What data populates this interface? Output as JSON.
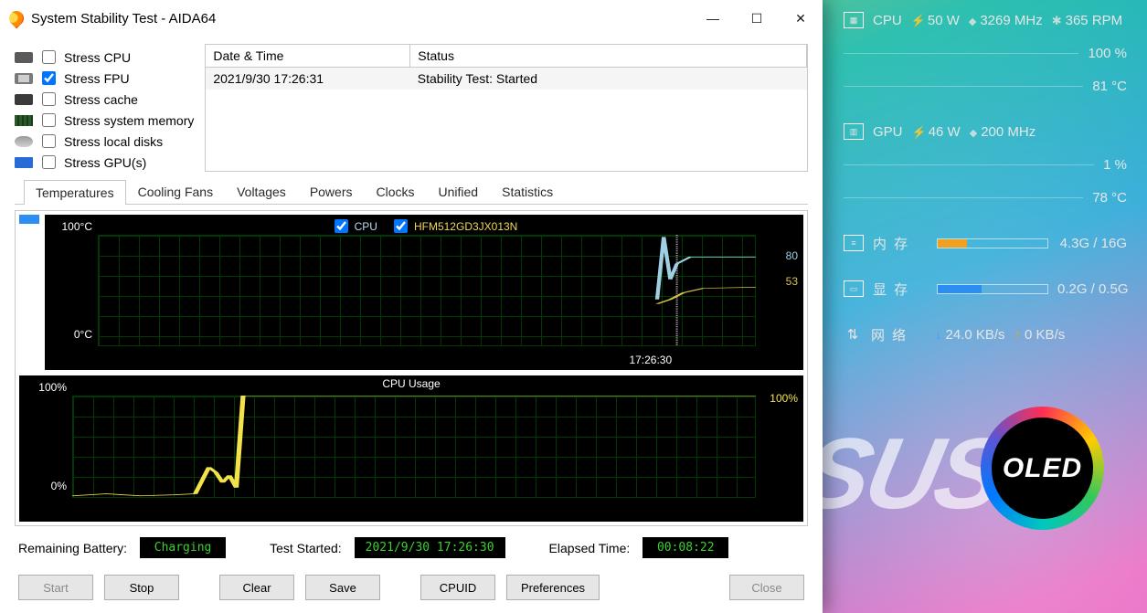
{
  "window": {
    "title": "System Stability Test - AIDA64"
  },
  "stress_tests": [
    {
      "label": "Stress CPU",
      "checked": false
    },
    {
      "label": "Stress FPU",
      "checked": true
    },
    {
      "label": "Stress cache",
      "checked": false
    },
    {
      "label": "Stress system memory",
      "checked": false
    },
    {
      "label": "Stress local disks",
      "checked": false
    },
    {
      "label": "Stress GPU(s)",
      "checked": false
    }
  ],
  "log": {
    "headers": {
      "datetime": "Date & Time",
      "status": "Status"
    },
    "rows": [
      {
        "datetime": "2021/9/30 17:26:31",
        "status": "Stability Test: Started"
      }
    ]
  },
  "tabs": [
    "Temperatures",
    "Cooling Fans",
    "Voltages",
    "Powers",
    "Clocks",
    "Unified",
    "Statistics"
  ],
  "active_tab": "Temperatures",
  "graph_temp": {
    "legend_cpu": "CPU",
    "legend_ssd": "HFM512GD3JX013N",
    "y_top": "100°C",
    "y_bot": "0°C",
    "val_cpu": "80",
    "val_ssd": "53",
    "xlabel": "17:26:30"
  },
  "graph_usage": {
    "title": "CPU Usage",
    "y_top": "100%",
    "y_bot": "0%",
    "val": "100%"
  },
  "status": {
    "battery_label": "Remaining Battery:",
    "battery_value": "Charging",
    "started_label": "Test Started:",
    "started_value": "2021/9/30 17:26:30",
    "elapsed_label": "Elapsed Time:",
    "elapsed_value": "00:08:22"
  },
  "buttons": {
    "start": "Start",
    "stop": "Stop",
    "clear": "Clear",
    "save": "Save",
    "cpuid": "CPUID",
    "prefs": "Preferences",
    "close": "Close"
  },
  "hud": {
    "cpu": {
      "label": "CPU",
      "power": "50 W",
      "clock": "3269 MHz",
      "fan": "365 RPM",
      "usage": "100 %",
      "temp": "81 °C"
    },
    "gpu": {
      "label": "GPU",
      "power": "46 W",
      "clock": "200 MHz",
      "usage": "1 %",
      "temp": "78 °C"
    },
    "mem": {
      "label": "内  存",
      "value": "4.3G / 16G",
      "pct": 27,
      "color": "#f0a020"
    },
    "vram": {
      "label": "显  存",
      "value": "0.2G / 0.5G",
      "pct": 40,
      "color": "#2c8ef0"
    },
    "net": {
      "label": "网  络",
      "down": "24.0 KB/s",
      "up": "0 KB/s"
    },
    "oled": "OLED"
  },
  "chart_data": [
    {
      "type": "line",
      "title": "Temperatures",
      "ylabel": "°C",
      "ylim": [
        0,
        100
      ],
      "xlabel": "17:26:30",
      "series": [
        {
          "name": "CPU",
          "current": 80,
          "trace": [
            null,
            null,
            null,
            null,
            null,
            42,
            98,
            74,
            81,
            80,
            80,
            80,
            80,
            80
          ]
        },
        {
          "name": "HFM512GD3JX013N",
          "current": 53,
          "trace": [
            null,
            null,
            null,
            null,
            null,
            38,
            40,
            46,
            50,
            52,
            53,
            53,
            53,
            53
          ]
        }
      ]
    },
    {
      "type": "line",
      "title": "CPU Usage",
      "ylabel": "%",
      "ylim": [
        0,
        100
      ],
      "series": [
        {
          "name": "CPU Usage",
          "current": 100,
          "trace": [
            2,
            3,
            2,
            4,
            2,
            3,
            5,
            30,
            25,
            15,
            20,
            10,
            100,
            100,
            100,
            100,
            100,
            100,
            100,
            100,
            100,
            100,
            100,
            100,
            100,
            100,
            100,
            100,
            100,
            100,
            100,
            100,
            100,
            100,
            100,
            100,
            100,
            100,
            100,
            100
          ]
        }
      ]
    }
  ]
}
